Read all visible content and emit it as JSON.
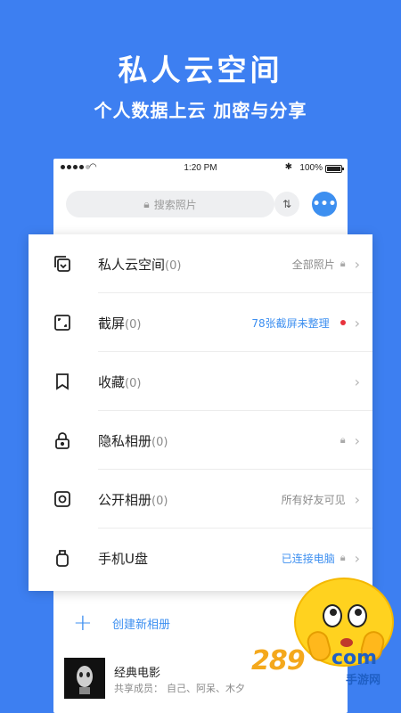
{
  "promo": {
    "headline": "私人云空间",
    "subheadline": "个人数据上云 加密与分享"
  },
  "status_bar": {
    "time": "1:20 PM",
    "battery": "100%",
    "bluetooth_glyph": "✱",
    "wifi_glyph": "◠"
  },
  "search": {
    "placeholder": "搜索照片"
  },
  "icons": {
    "lock": "🔒︎",
    "sort": "⇅",
    "more": "•••",
    "chevron": "›",
    "plus": "+"
  },
  "menu": {
    "items": [
      {
        "icon": "cloud-copy-icon",
        "title": "私人云空间",
        "count": "(0)",
        "right_text": "全部照片",
        "right_style": "gray",
        "lock": true,
        "dot": false
      },
      {
        "icon": "screenshot-icon",
        "title": "截屏",
        "count": "(0)",
        "right_text": "78张截屏未整理",
        "right_style": "blue",
        "lock": false,
        "dot": true
      },
      {
        "icon": "bookmark-icon",
        "title": "收藏",
        "count": "(0)",
        "right_text": "",
        "right_style": "gray",
        "lock": false,
        "dot": false
      },
      {
        "icon": "lock-icon",
        "title": "隐私相册",
        "count": "(0)",
        "right_text": "",
        "right_style": "gray",
        "lock": true,
        "dot": false
      },
      {
        "icon": "camera-icon",
        "title": "公开相册",
        "count": "(0)",
        "right_text": "所有好友可见",
        "right_style": "gray",
        "lock": false,
        "dot": false
      },
      {
        "icon": "usb-drive-icon",
        "title": "手机U盘",
        "count": "",
        "right_text": "已连接电脑",
        "right_style": "blue",
        "lock": true,
        "dot": false
      }
    ]
  },
  "create_album": {
    "label": "创建新相册"
  },
  "album": {
    "title": "经典电影",
    "members_label": "共享成员：",
    "members": "自己、阿呆、木夕"
  },
  "watermark": {
    "number": "289",
    "suffix": "com",
    "chinese": "手游网"
  },
  "colors": {
    "background": "#3d7ff1",
    "accent": "#3d8ff0",
    "alert_dot": "#e8323c"
  }
}
